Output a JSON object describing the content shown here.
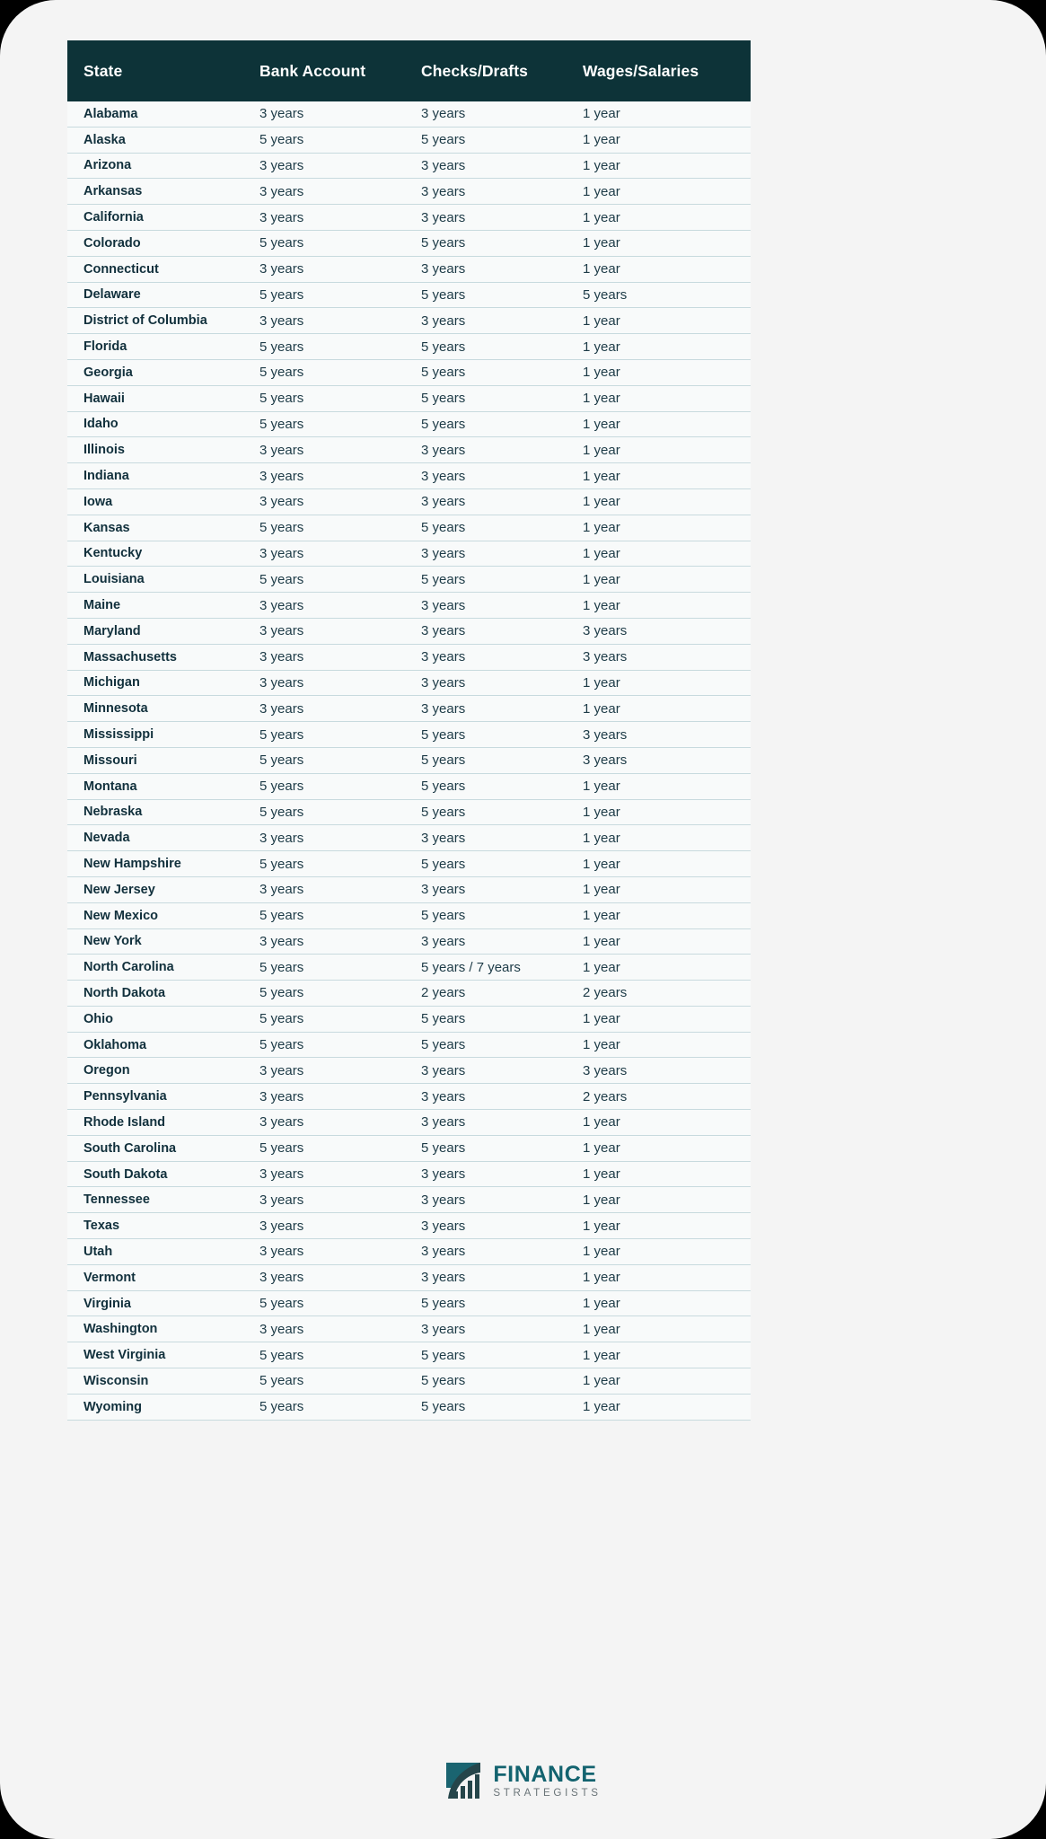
{
  "theme": {
    "page_background": "#000000",
    "card_background": "#f4f4f4",
    "header_background": "#0d3338",
    "header_text": "#ffffff",
    "row_background": "#f8fafa",
    "row_divider": "#c8dade",
    "state_text": "#11303c",
    "value_text": "#1d3b47",
    "logo_primary": "#13636f",
    "logo_secondary": "#6a7478"
  },
  "table": {
    "columns": [
      {
        "key": "state",
        "label": "State"
      },
      {
        "key": "bank",
        "label": "Bank Account"
      },
      {
        "key": "checks",
        "label": "Checks/Drafts"
      },
      {
        "key": "wages",
        "label": "Wages/Salaries"
      }
    ],
    "rows": [
      {
        "state": "Alabama",
        "bank": "3 years",
        "checks": "3 years",
        "wages": "1 year"
      },
      {
        "state": "Alaska",
        "bank": "5 years",
        "checks": "5 years",
        "wages": "1 year"
      },
      {
        "state": "Arizona",
        "bank": "3 years",
        "checks": "3 years",
        "wages": "1 year"
      },
      {
        "state": "Arkansas",
        "bank": "3 years",
        "checks": "3 years",
        "wages": "1 year"
      },
      {
        "state": "California",
        "bank": "3 years",
        "checks": "3 years",
        "wages": "1 year"
      },
      {
        "state": "Colorado",
        "bank": "5 years",
        "checks": "5 years",
        "wages": "1 year"
      },
      {
        "state": "Connecticut",
        "bank": "3 years",
        "checks": "3 years",
        "wages": "1 year"
      },
      {
        "state": "Delaware",
        "bank": "5 years",
        "checks": "5 years",
        "wages": "5 years"
      },
      {
        "state": "District of Columbia",
        "bank": "3 years",
        "checks": "3 years",
        "wages": "1 year"
      },
      {
        "state": "Florida",
        "bank": "5 years",
        "checks": "5 years",
        "wages": "1 year"
      },
      {
        "state": "Georgia",
        "bank": "5 years",
        "checks": "5 years",
        "wages": "1 year"
      },
      {
        "state": "Hawaii",
        "bank": "5 years",
        "checks": "5 years",
        "wages": "1 year"
      },
      {
        "state": "Idaho",
        "bank": "5 years",
        "checks": "5 years",
        "wages": "1 year"
      },
      {
        "state": "Illinois",
        "bank": "3 years",
        "checks": "3 years",
        "wages": "1 year"
      },
      {
        "state": "Indiana",
        "bank": "3 years",
        "checks": "3 years",
        "wages": "1 year"
      },
      {
        "state": "Iowa",
        "bank": "3 years",
        "checks": "3 years",
        "wages": "1 year"
      },
      {
        "state": "Kansas",
        "bank": "5 years",
        "checks": "5 years",
        "wages": "1 year"
      },
      {
        "state": "Kentucky",
        "bank": "3 years",
        "checks": "3 years",
        "wages": "1 year"
      },
      {
        "state": "Louisiana",
        "bank": "5 years",
        "checks": "5 years",
        "wages": "1 year"
      },
      {
        "state": "Maine",
        "bank": "3 years",
        "checks": "3 years",
        "wages": "1 year"
      },
      {
        "state": "Maryland",
        "bank": "3 years",
        "checks": "3 years",
        "wages": "3 years"
      },
      {
        "state": "Massachusetts",
        "bank": "3 years",
        "checks": "3 years",
        "wages": "3 years"
      },
      {
        "state": "Michigan",
        "bank": "3 years",
        "checks": "3 years",
        "wages": "1 year"
      },
      {
        "state": "Minnesota",
        "bank": "3 years",
        "checks": "3 years",
        "wages": "1 year"
      },
      {
        "state": "Mississippi",
        "bank": "5 years",
        "checks": "5 years",
        "wages": "3 years"
      },
      {
        "state": "Missouri",
        "bank": "5 years",
        "checks": "5 years",
        "wages": "3 years"
      },
      {
        "state": "Montana",
        "bank": "5 years",
        "checks": "5 years",
        "wages": "1 year"
      },
      {
        "state": "Nebraska",
        "bank": "5 years",
        "checks": "5 years",
        "wages": "1 year"
      },
      {
        "state": "Nevada",
        "bank": "3 years",
        "checks": "3 years",
        "wages": "1 year"
      },
      {
        "state": "New Hampshire",
        "bank": "5 years",
        "checks": "5 years",
        "wages": "1 year"
      },
      {
        "state": "New Jersey",
        "bank": "3 years",
        "checks": "3 years",
        "wages": "1 year"
      },
      {
        "state": "New Mexico",
        "bank": "5 years",
        "checks": "5 years",
        "wages": "1 year"
      },
      {
        "state": "New York",
        "bank": "3 years",
        "checks": "3 years",
        "wages": "1 year"
      },
      {
        "state": "North Carolina",
        "bank": "5 years",
        "checks": "5 years / 7 years",
        "wages": "1 year"
      },
      {
        "state": "North Dakota",
        "bank": "5 years",
        "checks": "2 years",
        "wages": "2 years"
      },
      {
        "state": "Ohio",
        "bank": "5 years",
        "checks": "5 years",
        "wages": "1 year"
      },
      {
        "state": "Oklahoma",
        "bank": "5 years",
        "checks": "5 years",
        "wages": "1 year"
      },
      {
        "state": "Oregon",
        "bank": "3 years",
        "checks": "3 years",
        "wages": "3 years"
      },
      {
        "state": "Pennsylvania",
        "bank": "3 years",
        "checks": "3 years",
        "wages": "2 years"
      },
      {
        "state": "Rhode Island",
        "bank": "3 years",
        "checks": "3 years",
        "wages": "1 year"
      },
      {
        "state": "South Carolina",
        "bank": "5 years",
        "checks": "5 years",
        "wages": "1 year"
      },
      {
        "state": "South Dakota",
        "bank": "3 years",
        "checks": "3 years",
        "wages": "1 year"
      },
      {
        "state": "Tennessee",
        "bank": "3 years",
        "checks": "3 years",
        "wages": "1 year"
      },
      {
        "state": "Texas",
        "bank": "3 years",
        "checks": "3 years",
        "wages": "1 year"
      },
      {
        "state": "Utah",
        "bank": "3 years",
        "checks": "3 years",
        "wages": "1 year"
      },
      {
        "state": "Vermont",
        "bank": "3 years",
        "checks": "3 years",
        "wages": "1 year"
      },
      {
        "state": "Virginia",
        "bank": "5 years",
        "checks": "5 years",
        "wages": "1 year"
      },
      {
        "state": "Washington",
        "bank": "3 years",
        "checks": "3 years",
        "wages": "1 year"
      },
      {
        "state": "West Virginia",
        "bank": "5 years",
        "checks": "5 years",
        "wages": "1 year"
      },
      {
        "state": "Wisconsin",
        "bank": "5 years",
        "checks": "5 years",
        "wages": "1 year"
      },
      {
        "state": "Wyoming",
        "bank": "5 years",
        "checks": "5 years",
        "wages": "1 year"
      }
    ]
  },
  "footer": {
    "logo_icon": "finance-strategists-logo-icon",
    "logo_word": "FINANCE",
    "logo_sub": "STRATEGISTS"
  }
}
